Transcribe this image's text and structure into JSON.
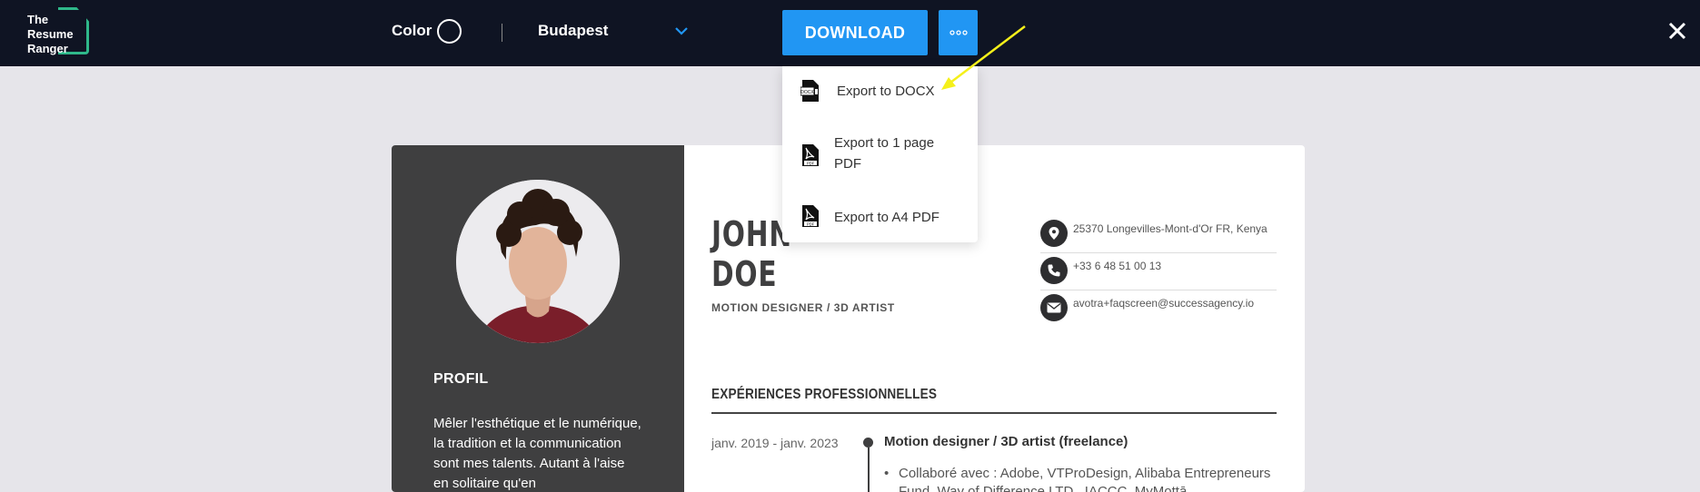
{
  "topbar": {
    "logo_text": "The\nResume\nRanger",
    "color_label": "Color",
    "template_name": "Budapest",
    "download_label": "DOWNLOAD",
    "more_label": "°°°",
    "close_label": "✕"
  },
  "export_menu": {
    "items": [
      {
        "label": "Export to DOCX",
        "icon": "docx-file-icon"
      },
      {
        "label": "Export to 1 page PDF",
        "icon": "pdf-file-icon"
      },
      {
        "label": "Export to A4 PDF",
        "icon": "pdf-file-icon"
      }
    ]
  },
  "resume": {
    "name_line1": "JOHN",
    "name_line2": "DOE",
    "job_title": "MOTION DESIGNER / 3D ARTIST",
    "contacts": [
      {
        "icon": "location-pin-icon",
        "text": "25370 Longevilles-Mont-d'Or FR, Kenya"
      },
      {
        "icon": "phone-icon",
        "text": "+33 6 48 51 00 13"
      },
      {
        "icon": "mail-icon",
        "text": "avotra+faqscreen@successagency.io"
      }
    ],
    "profil_heading": "PROFIL",
    "profil_text": "Mêler l'esthétique et le numérique, la tradition et la communication sont mes talents. Autant à l'aise en solitaire qu'en",
    "experience_heading": "EXPÉRIENCES PROFESSIONNELLES",
    "experience": [
      {
        "date": "janv. 2019 - janv. 2023",
        "role": "Motion designer / 3D artist (freelance)",
        "bullet": "Collaboré avec : Adobe, VTProDesign, Alibaba Entrepreneurs Fund, Way of Difference LTD., IACCC, MyMottā,"
      }
    ]
  },
  "colors": {
    "topbar_bg": "#0f1423",
    "accent_blue": "#2196f3",
    "logo_green": "#2fb88a",
    "sidebar_bg": "#3f3f40",
    "page_bg": "#e6e5ea",
    "annotation_arrow": "#f5f01a"
  }
}
